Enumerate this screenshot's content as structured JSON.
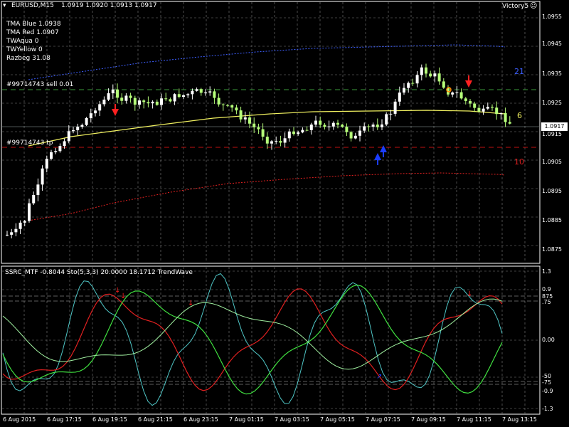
{
  "header": {
    "symbol": "EURUSD,M15",
    "ohlc": "1.0919 1.0920 1.0913 1.0917",
    "expert": "Victory5",
    "expert_icon": "smiley-icon"
  },
  "indicators": [
    "TMA Blue 1.0938",
    "TMA Red 1.0907",
    "TWAqua 0",
    "TWYellow 0",
    "Razbeg 31.08"
  ],
  "orders": {
    "sell": "#99714743 sell 0.01",
    "tp": "#99714743 tp"
  },
  "right_labels": {
    "blue": "21",
    "yellow": "6",
    "red": "10"
  },
  "price_axis": [
    "1.0955",
    "1.0945",
    "1.0935",
    "1.0925",
    "1.0917",
    "1.0915",
    "1.0905",
    "1.0895",
    "1.0885",
    "1.0875"
  ],
  "current_price": "1.0917",
  "sub_window": {
    "title": "SSRC_MTF -0.8044  Sto(5,3,3) 20.0000 18.1712  TrendWave",
    "axis": [
      "1.3",
      "0.9",
      "875",
      ".75",
      "0.00",
      "-50",
      "-75",
      "-0.9",
      "-1.3"
    ]
  },
  "time_axis": [
    "6 Aug 2015",
    "6 Aug 17:15",
    "6 Aug 19:15",
    "6 Aug 21:15",
    "6 Aug 23:15",
    "7 Aug 01:15",
    "7 Aug 03:15",
    "7 Aug 05:15",
    "7 Aug 07:15",
    "7 Aug 09:15",
    "7 Aug 11:15",
    "7 Aug 13:15"
  ],
  "colors": {
    "bull": "#ffffff",
    "bear": "#b6ff7a",
    "tma_blue": "#3d5fff",
    "tma_red": "#e02020",
    "ma_yellow": "#f0f060",
    "grid": "#808080",
    "signal_up": "#1a3cff",
    "signal_down": "#ff2020"
  }
}
